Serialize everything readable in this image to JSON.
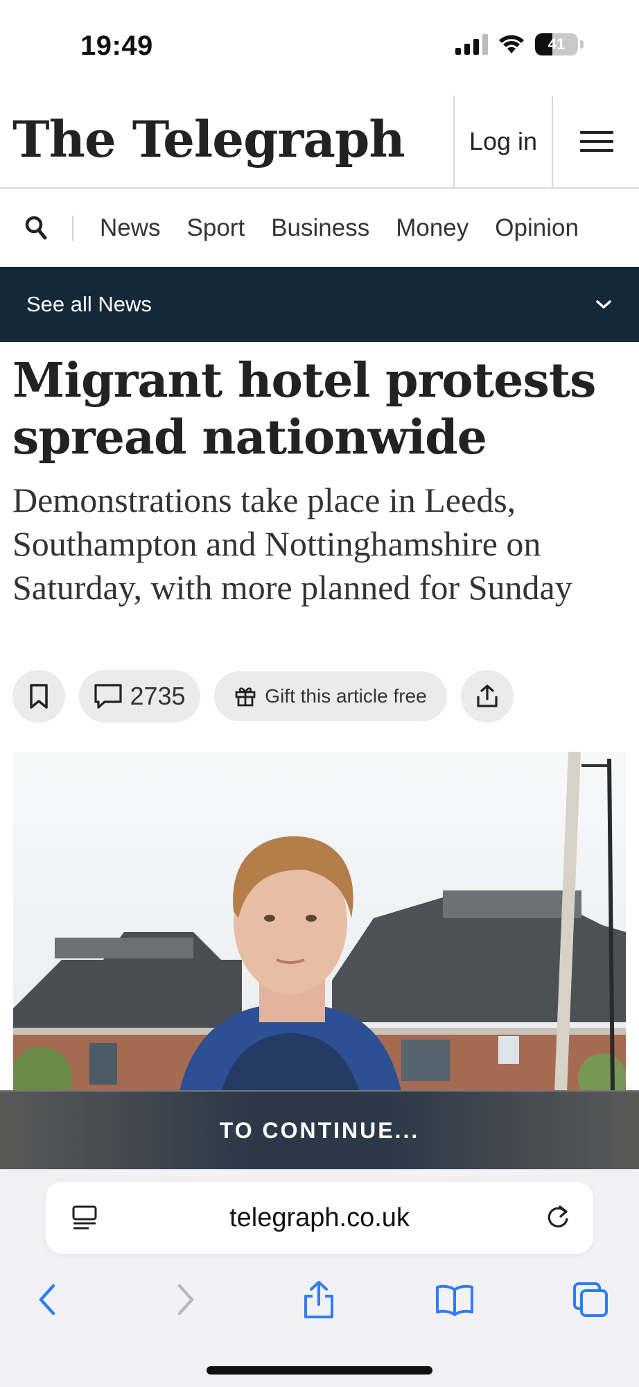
{
  "status_bar": {
    "time": "19:49",
    "battery": "41"
  },
  "masthead": {
    "logo": "The Telegraph",
    "login_label": "Log in"
  },
  "nav": {
    "items": [
      "News",
      "Sport",
      "Business",
      "Money",
      "Opinion"
    ]
  },
  "section_bar": {
    "label": "See all News"
  },
  "article": {
    "headline": "Migrant hotel protests spread nationwide",
    "standfirst": "Demonstrations take place in Leeds, Southampton and Nottinghamshire on Saturday, with more planned for Sunday",
    "comment_count": "2735",
    "gift_label": "Gift this article free"
  },
  "banner": {
    "label": "TO CONTINUE..."
  },
  "browser": {
    "url": "telegraph.co.uk"
  },
  "colors": {
    "section_bar": "#13293a",
    "safari_blue": "#2f7cf6"
  }
}
